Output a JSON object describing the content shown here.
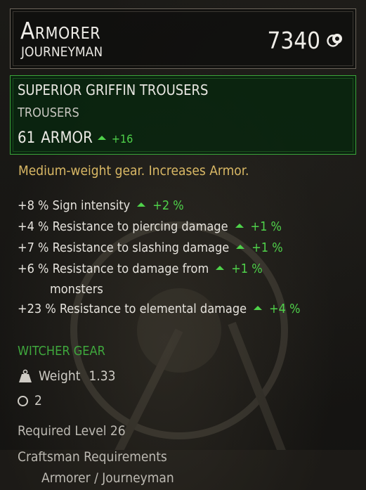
{
  "header": {
    "craftsman_name": "Armorer",
    "craftsman_level": "Journeyman",
    "price": "7340",
    "currency_icon": "crowns-coin-icon"
  },
  "item": {
    "name": "SUPERIOR GRIFFIN TROUSERS",
    "type": "TROUSERS",
    "armor_value": "61",
    "armor_label": "ARMOR",
    "armor_delta": "+16"
  },
  "description": "Medium-weight gear. Increases Armor.",
  "stats": [
    {
      "value": "+8 %",
      "label": "Sign intensity",
      "delta": "+2 %"
    },
    {
      "value": "+4 %",
      "label": "Resistance to piercing damage",
      "delta": "+1 %"
    },
    {
      "value": "+7 %",
      "label": "Resistance to slashing damage",
      "delta": "+1 %"
    },
    {
      "value": "+6 %",
      "label": "Resistance to damage from",
      "label_cont": "monsters",
      "delta": "+1 %"
    },
    {
      "value": "+23 %",
      "label": "Resistance to elemental damage",
      "delta": "+4 %"
    }
  ],
  "gear_set": "WITCHER GEAR",
  "weight": {
    "label": "Weight",
    "value": "1.33",
    "icon": "weight-icon"
  },
  "slots": {
    "value": "2",
    "icon": "slot-circle-icon"
  },
  "required_level": "Required Level 26",
  "craftsman_requirements": {
    "title": "Craftsman Requirements",
    "value": "Armorer / Journeyman"
  },
  "colors": {
    "positive": "#4fd24a",
    "description": "#d9b865",
    "witcher_gear": "#3fa83d",
    "item_border": "#3aa53a"
  }
}
